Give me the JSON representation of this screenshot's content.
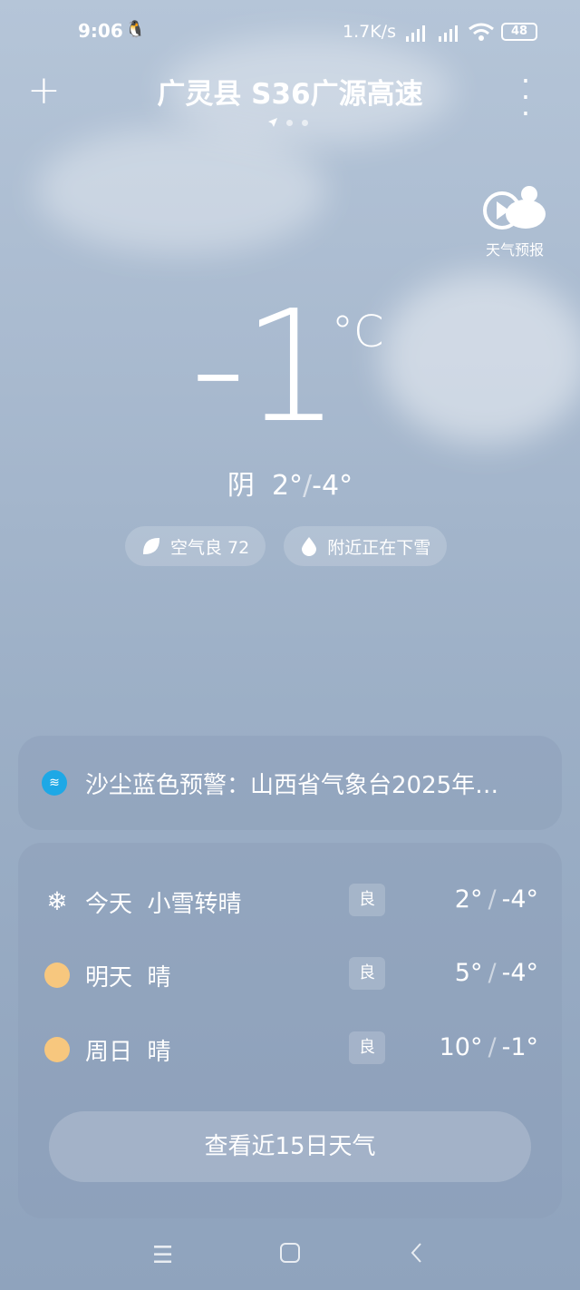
{
  "status_bar": {
    "time": "9:06",
    "net_speed": "1.7K/s",
    "battery": "48"
  },
  "header": {
    "location": "广灵县 S36广源高速"
  },
  "forecast_video": {
    "label": "天气预报"
  },
  "current": {
    "temperature": "-1",
    "unit": "°C",
    "condition": "阴",
    "high": "2°",
    "low": "-4°"
  },
  "chips": {
    "air_quality": "空气良 72",
    "precipitation": "附近正在下雪"
  },
  "alert": {
    "text": "沙尘蓝色预警：山西省气象台2025年…"
  },
  "forecast": [
    {
      "day": "今天",
      "condition": "小雪转晴",
      "aqi": "良",
      "high": "2°",
      "low": "-4°",
      "icon": "snowflake-icon"
    },
    {
      "day": "明天",
      "condition": "晴",
      "aqi": "良",
      "high": "5°",
      "low": "-4°",
      "icon": "sun-icon"
    },
    {
      "day": "周日",
      "condition": "晴",
      "aqi": "良",
      "high": "10°",
      "low": "-1°",
      "icon": "sun-icon"
    }
  ],
  "forecast_button": "查看近15日天气",
  "slash": "/"
}
